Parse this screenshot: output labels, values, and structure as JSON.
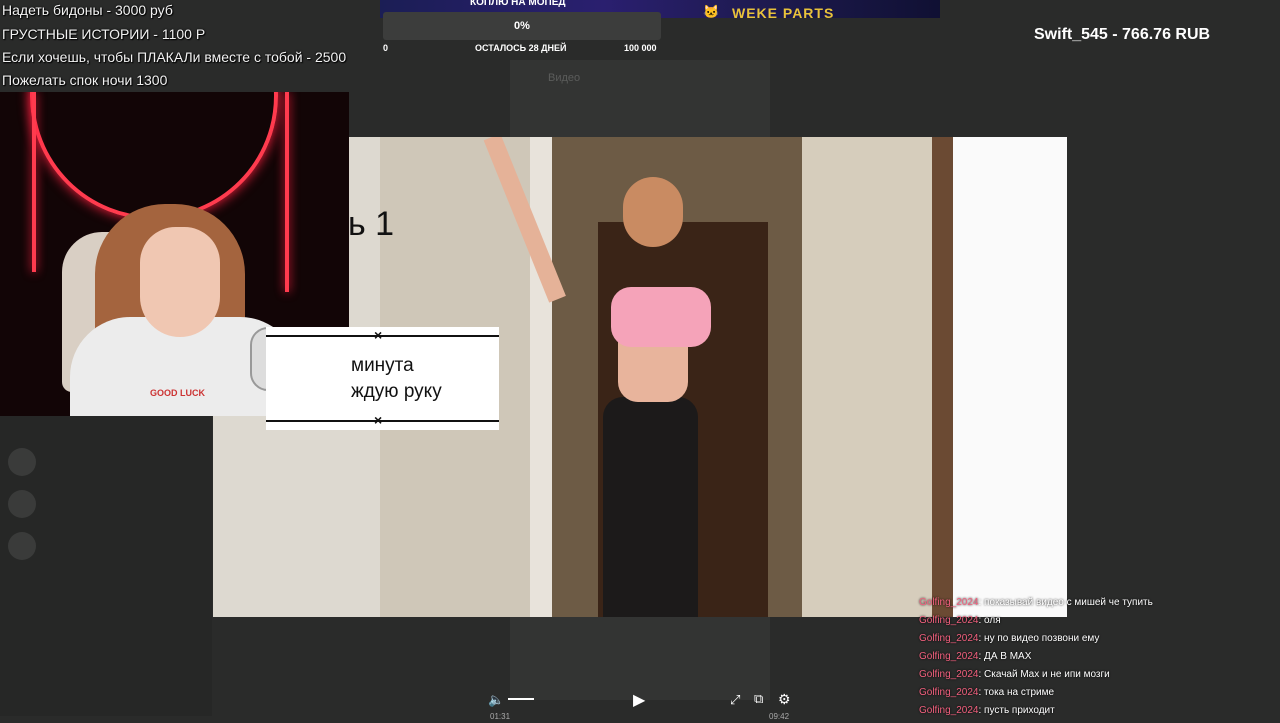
{
  "banner": {
    "text": "WEKE PARTS",
    "cat_icon": "cat-icon"
  },
  "donations": [
    "Надеть бидоны - 3000 руб",
    "ГРУСТНЫЕ ИСТОРИИ - 1100 Р",
    "Если хочешь, чтобы ПЛАКАЛи вместе с тобой - 2500",
    "Пожелать спок ночи 1300"
  ],
  "goal": {
    "title": "КОПЛЮ НА МОПЕД",
    "percent_label": "0%",
    "progress": 0,
    "start": "0",
    "days_left": "ОСТАЛОСЬ 28 ДНЕЙ",
    "target": "100 000",
    "fill_color": "#7fe07a"
  },
  "top_donor": "Swift_545 - 766.76 RUB",
  "background_window": {
    "title": "Видео"
  },
  "webcam": {
    "shirt_text": "GOOD LUCK"
  },
  "video_overlay": {
    "big_caption": "ь 1",
    "line1": "минута",
    "line2": "ждую руку",
    "x_mark": "×"
  },
  "player": {
    "volume_icon": "volume-icon",
    "play_icon": "play-icon",
    "fullscreen_icon": "fullscreen-icon",
    "pip_icon": "pip-icon",
    "settings_icon": "settings-icon",
    "time_current": "01:31",
    "time_total": "09:42"
  },
  "chat": [
    {
      "user": "Golfing_2024",
      "text": ": показывай видео с мишей че тупить"
    },
    {
      "user": "Golfing_2024",
      "text": ": оля"
    },
    {
      "user": "Golfing_2024",
      "text": ": ну по видео позвони ему"
    },
    {
      "user": "Golfing_2024",
      "text": ": ДА В MAX"
    },
    {
      "user": "Golfing_2024",
      "text": ": Скачай Max и не ипи мозги"
    },
    {
      "user": "Golfing_2024",
      "text": ": тока на стриме"
    },
    {
      "user": "Golfing_2024",
      "text": ": пусть приходит"
    }
  ],
  "colors": {
    "chat_user": "#f2607e",
    "neon": "#ff3b4e"
  }
}
